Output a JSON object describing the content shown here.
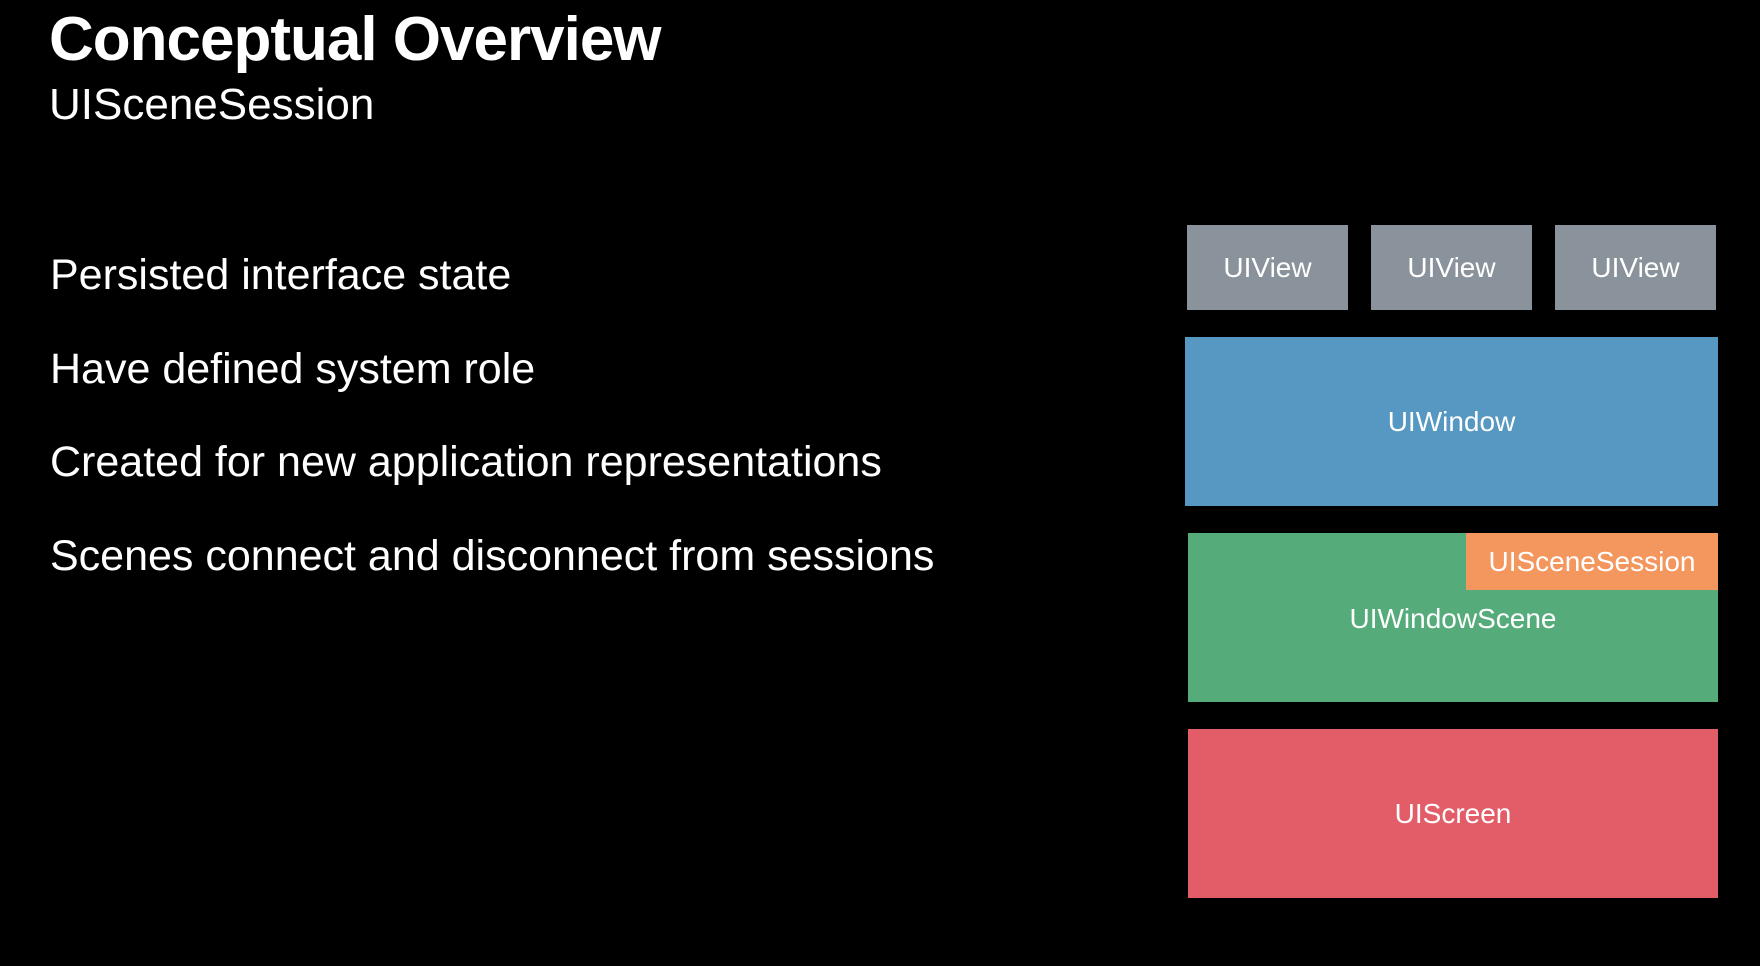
{
  "slide": {
    "title": "Conceptual Overview",
    "subtitle": "UISceneSession"
  },
  "bullets": [
    "Persisted interface state",
    "Have defined system role",
    "Created for new application representations",
    "Scenes connect and disconnect from sessions"
  ],
  "diagram": {
    "views": [
      {
        "label": "UIView"
      },
      {
        "label": "UIView"
      },
      {
        "label": "UIView"
      }
    ],
    "window": {
      "label": "UIWindow"
    },
    "window_scene": {
      "label": "UIWindowScene"
    },
    "scene_session": {
      "label": "UISceneSession"
    },
    "screen": {
      "label": "UIScreen"
    }
  },
  "colors": {
    "background": "#000000",
    "view": "#8a939c",
    "window": "#5698c2",
    "window_scene": "#55ac7a",
    "scene_session": "#f4975f",
    "screen": "#e35d69"
  }
}
